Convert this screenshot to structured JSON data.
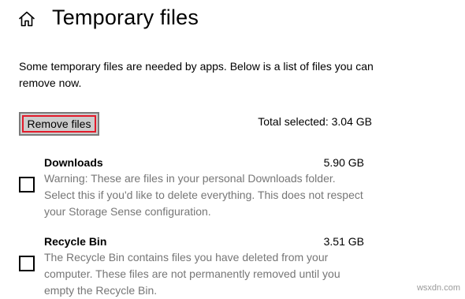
{
  "header": {
    "title": "Temporary files",
    "home_icon": "home-icon"
  },
  "intro_text": "Some temporary files are needed by apps. Below is a list of files you can remove now.",
  "actions": {
    "remove_label": "Remove files",
    "total_selected": "Total selected: 3.04 GB",
    "highlight_color": "#e21b2b"
  },
  "items": [
    {
      "name": "Downloads",
      "size": "5.90 GB",
      "checked": false,
      "description": "Warning: These are files in your personal Downloads folder. Select this if you'd like to delete everything. This does not respect your Storage Sense configuration."
    },
    {
      "name": "Recycle Bin",
      "size": "3.51 GB",
      "checked": false,
      "description": "The Recycle Bin contains files you have deleted from your computer. These files are not permanently removed until you empty the Recycle Bin."
    }
  ],
  "watermark": "wsxdn.com"
}
